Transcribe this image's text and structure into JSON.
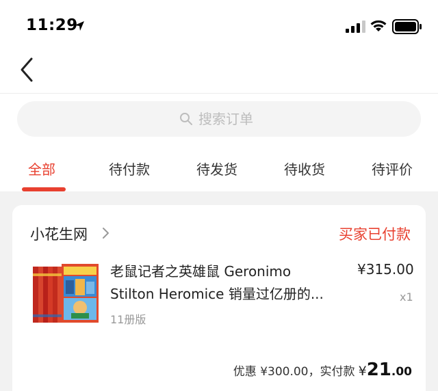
{
  "status_bar": {
    "time": "11:29"
  },
  "search": {
    "placeholder": "搜索订单"
  },
  "tabs": [
    {
      "label": "全部"
    },
    {
      "label": "待付款"
    },
    {
      "label": "待发货"
    },
    {
      "label": "待收货"
    },
    {
      "label": "待评价"
    }
  ],
  "active_tab": "全部",
  "order": {
    "shop_name": "小花生网",
    "status": "买家已付款",
    "product": {
      "title_line1": "老鼠记者之英雄鼠 Geronimo",
      "title_line2": "Stilton Heromice 销量过亿册的...",
      "variant": "11册版",
      "price": "¥315.00",
      "quantity": "x1"
    },
    "summary": {
      "discount_text": "优惠 ¥300.00，实付款",
      "currency": "¥",
      "paid_integer": "21",
      "paid_decimal": ".00"
    }
  },
  "colors": {
    "accent": "#e8402f",
    "muted": "#999999",
    "background": "#f2f2f2"
  }
}
